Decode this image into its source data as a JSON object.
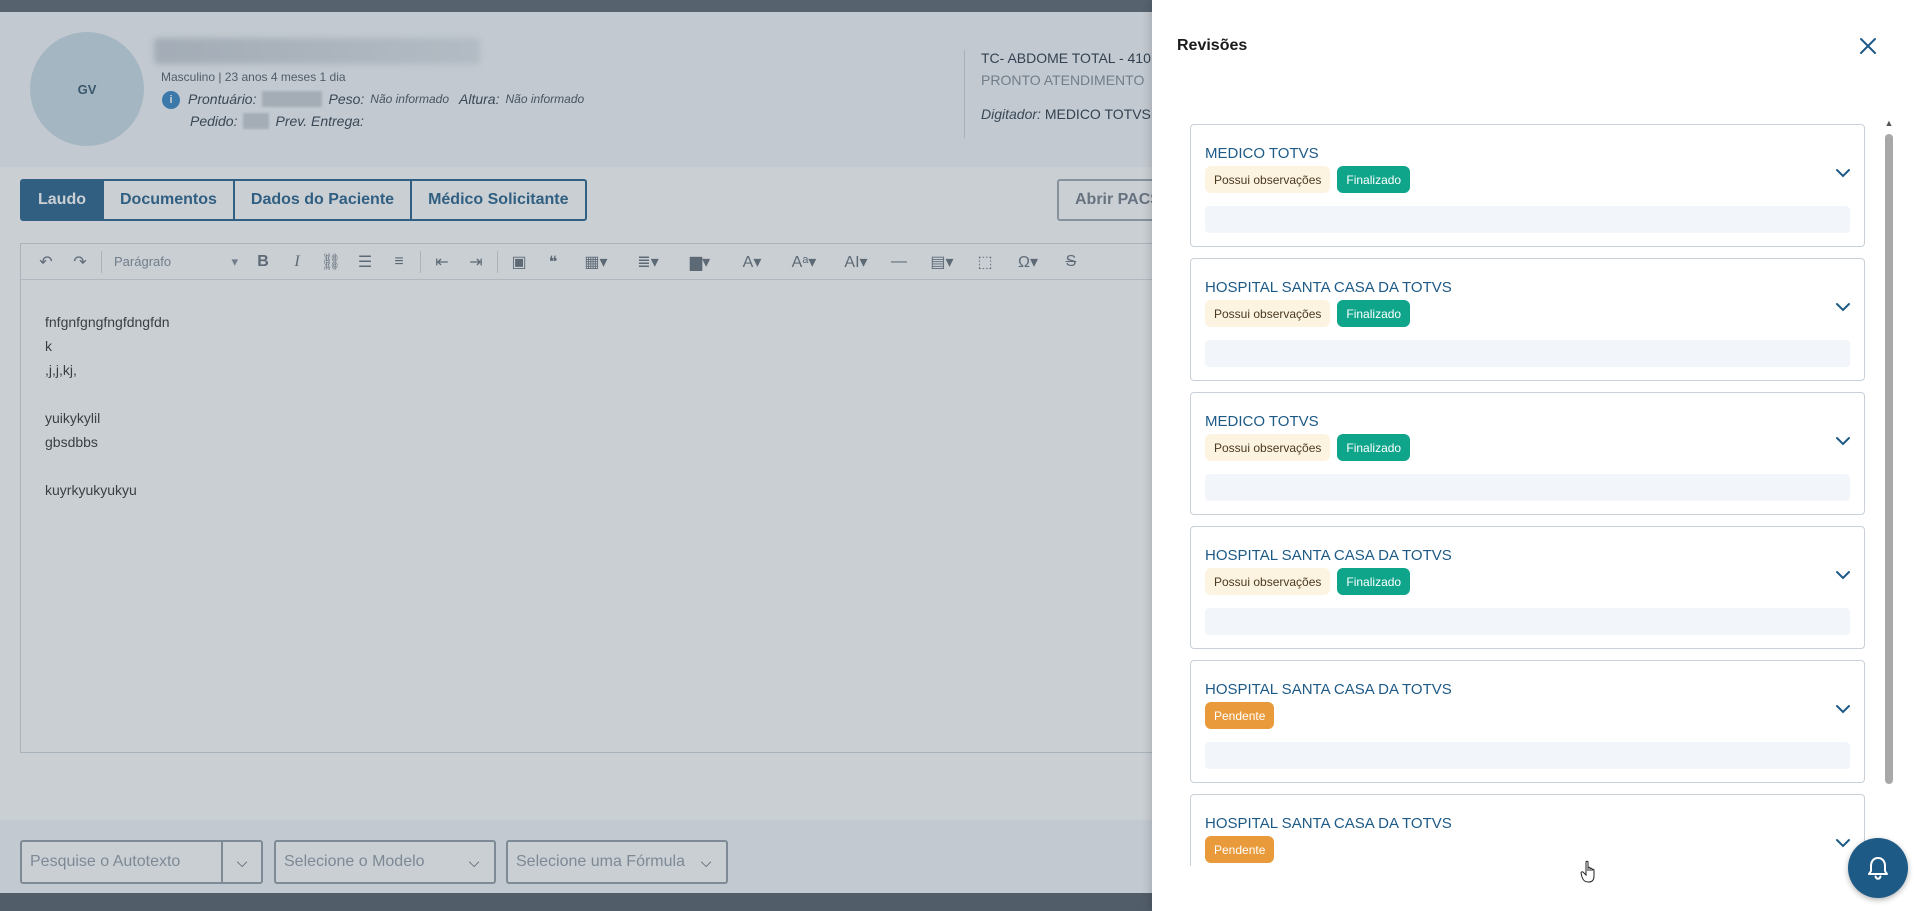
{
  "patient": {
    "avatar_initials": "GV",
    "sex_age": "Masculino | 23 anos 4 meses 1 dia",
    "prontuario_label": "Prontuário:",
    "peso_label": "Peso:",
    "peso_value": "Não informado",
    "altura_label": "Altura:",
    "altura_value": "Não informado",
    "pedido_label": "Pedido:",
    "prev_entrega_label": "Prev. Entrega:"
  },
  "exam": {
    "title": "TC- ABDOME TOTAL - 410",
    "unit": "PRONTO ATENDIMENTO",
    "digitador_label": "Digitador:",
    "digitador_value": "MEDICO TOTVS"
  },
  "tabs": [
    {
      "label": "Laudo",
      "active": true
    },
    {
      "label": "Documentos",
      "active": false
    },
    {
      "label": "Dados do Paciente",
      "active": false
    },
    {
      "label": "Médico Solicitante",
      "active": false
    }
  ],
  "pacs_button": "Abrir PACS",
  "editor": {
    "paragraph_style": "Parágrafo",
    "lines": [
      " fnfgnfgngfngfdngfdn",
      "k",
      ",j,j,kj,",
      "",
      "yuikykylil",
      "gbsdbbs",
      "",
      "kuyrkyukyukyu"
    ]
  },
  "bottom": {
    "autotexto_placeholder": "Pesquise o Autotexto",
    "modelo_placeholder": "Selecione o Modelo",
    "formula_placeholder": "Selecione uma Fórmula"
  },
  "drawer": {
    "title": "Revisões",
    "revisions": [
      {
        "author": "MEDICO TOTVS",
        "badges": [
          {
            "text": "Possui observações",
            "kind": "obs"
          },
          {
            "text": "Finalizado",
            "kind": "fin"
          }
        ]
      },
      {
        "author": "HOSPITAL SANTA CASA DA TOTVS",
        "badges": [
          {
            "text": "Possui observações",
            "kind": "obs"
          },
          {
            "text": "Finalizado",
            "kind": "fin"
          }
        ]
      },
      {
        "author": "MEDICO TOTVS",
        "badges": [
          {
            "text": "Possui observações",
            "kind": "obs"
          },
          {
            "text": "Finalizado",
            "kind": "fin"
          }
        ]
      },
      {
        "author": "HOSPITAL SANTA CASA DA TOTVS",
        "badges": [
          {
            "text": "Possui observações",
            "kind": "obs"
          },
          {
            "text": "Finalizado",
            "kind": "fin"
          }
        ]
      },
      {
        "author": "HOSPITAL SANTA CASA DA TOTVS",
        "badges": [
          {
            "text": "Pendente",
            "kind": "pen"
          }
        ]
      },
      {
        "author": "HOSPITAL SANTA CASA DA TOTVS",
        "badges": [
          {
            "text": "Pendente",
            "kind": "pen"
          }
        ]
      }
    ]
  },
  "colors": {
    "primary": "#1d5a86",
    "finalizado": "#0ea58b",
    "pendente": "#e99a3a",
    "observacoes_bg": "#fdf3e1"
  }
}
